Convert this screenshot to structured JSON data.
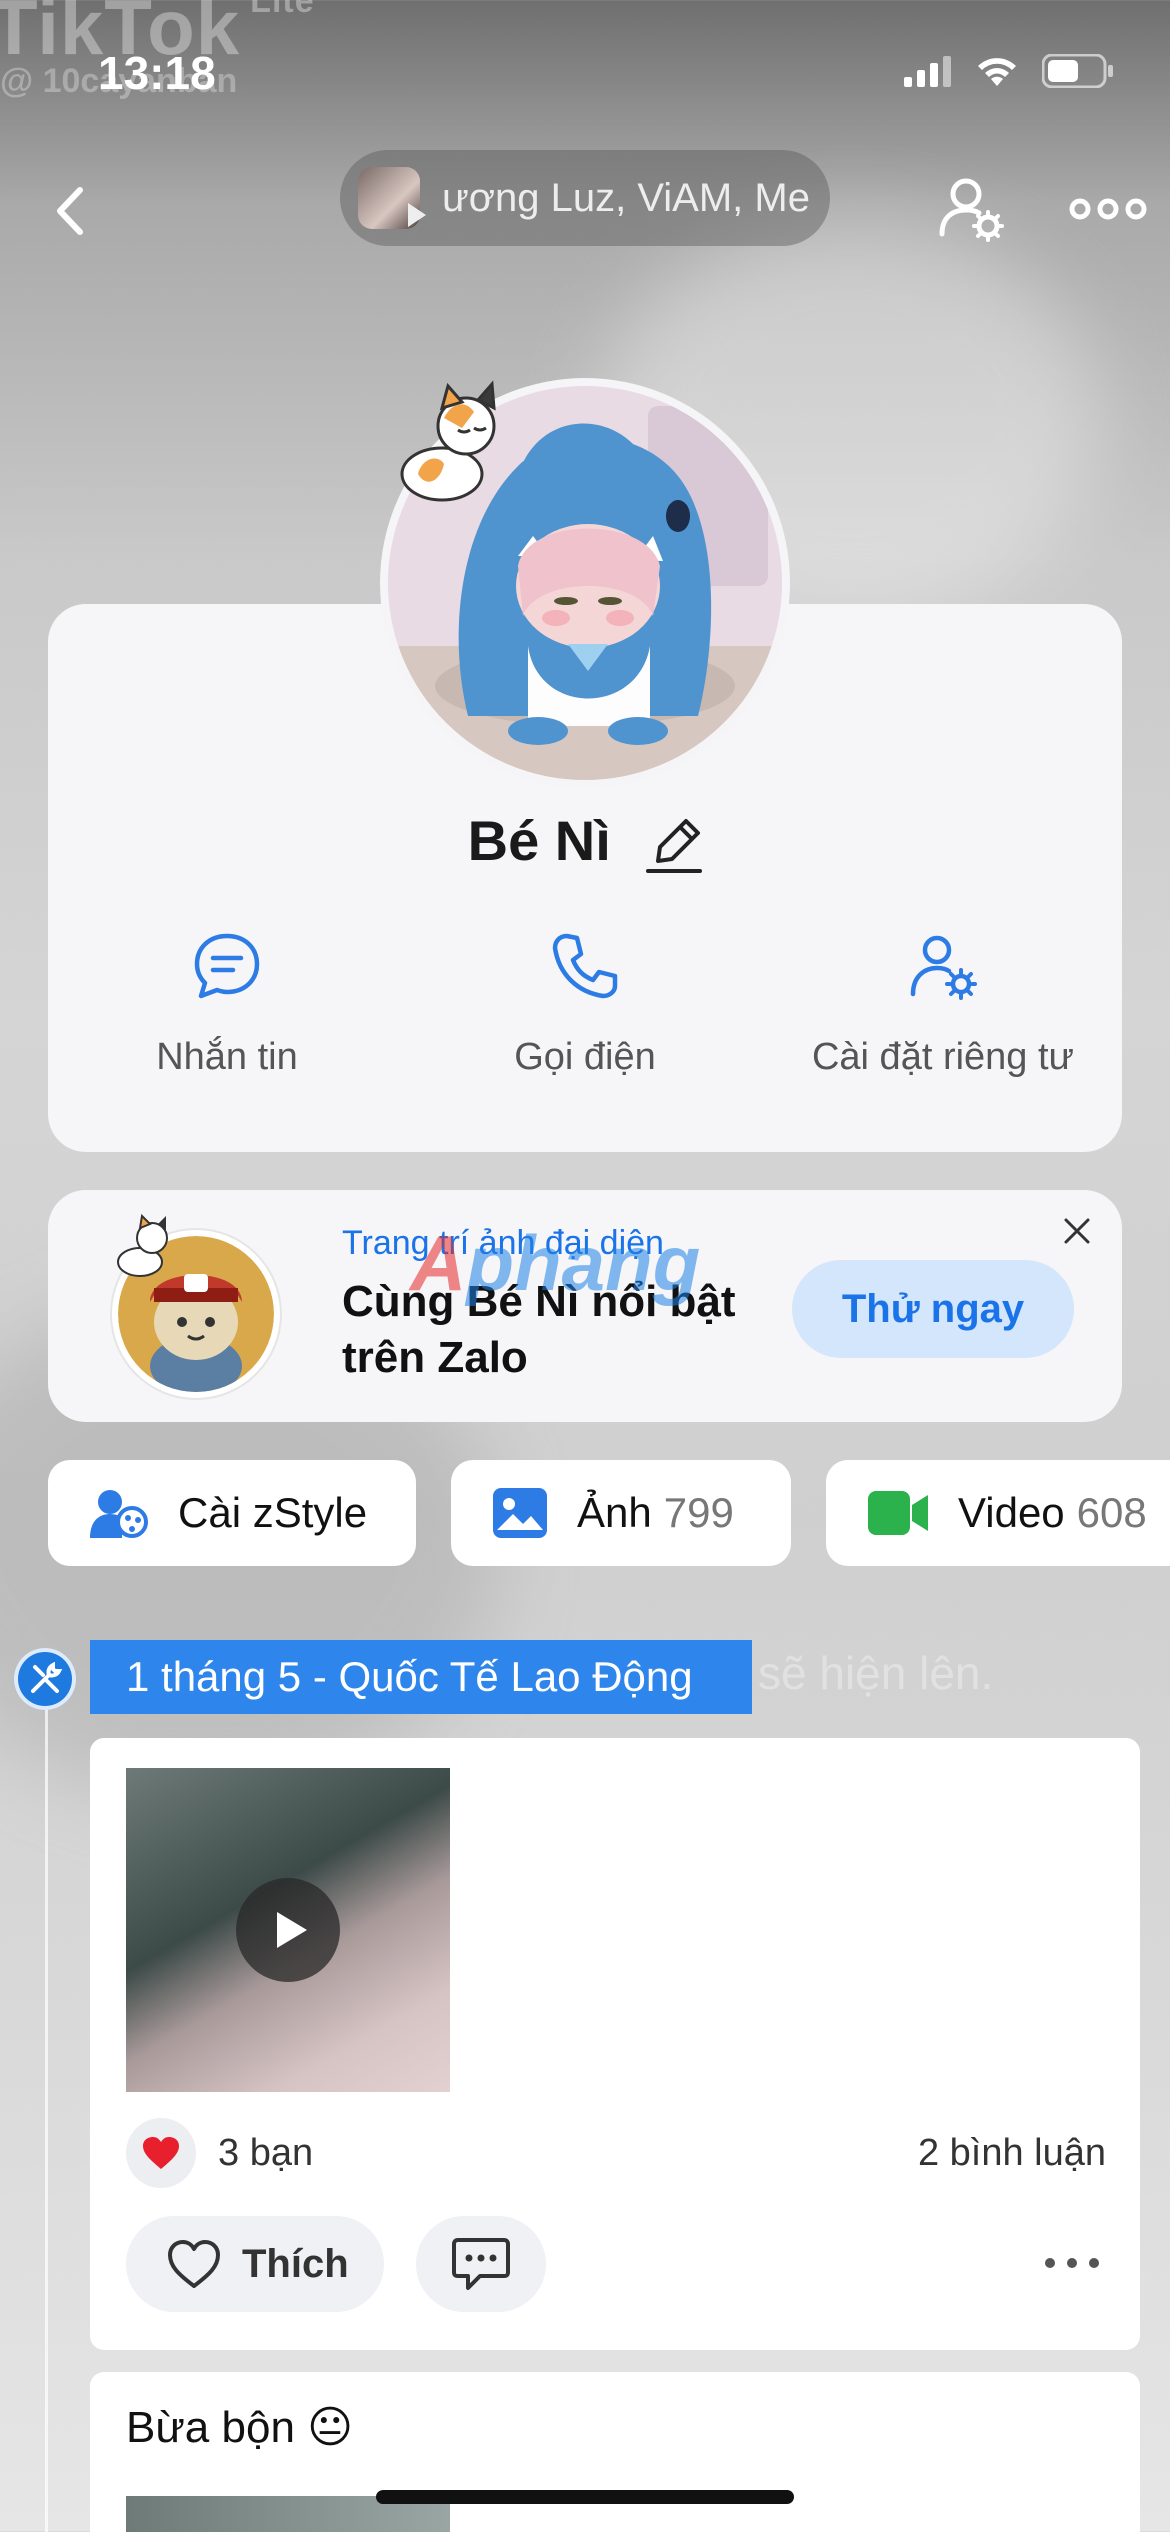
{
  "status_bar": {
    "time": "13:18",
    "watermark_app": "TikTok",
    "watermark_suffix": "Lite",
    "watermark_handle": "@ 10cayanban"
  },
  "nav": {
    "music_text": "ương Luz, ViAM, Me"
  },
  "profile": {
    "name": "Bé Nì",
    "actions": [
      {
        "label": "Nhắn tin",
        "icon": "chat-bubble-icon"
      },
      {
        "label": "Gọi điện",
        "icon": "phone-icon"
      },
      {
        "label": "Cài đặt riêng tư",
        "icon": "user-settings-icon"
      }
    ]
  },
  "promo": {
    "subtitle": "Trang trí ảnh đại diện",
    "title": "Cùng Bé Nì nổi bật trên Zalo",
    "button": "Thử ngay"
  },
  "watermark_brand": {
    "part1": "A",
    "part2": "phang"
  },
  "chips": [
    {
      "label": "Cài zStyle",
      "count": ""
    },
    {
      "label": "Ảnh",
      "count": "799"
    },
    {
      "label": "Video",
      "count": "608"
    }
  ],
  "background_text": {
    "line1": "sẽ hiện lên."
  },
  "timeline": {
    "event_label": "1 tháng 5 - Quốc Tế Lao Động"
  },
  "post": {
    "reactions": "3 bạn",
    "comments": "2 bình luận",
    "like_label": "Thích"
  },
  "post2": {
    "text": "Bừa bộn 😐"
  },
  "colors": {
    "accent": "#1a73e8",
    "event_blue": "#2e86ec",
    "video_green": "#2bb24c"
  }
}
